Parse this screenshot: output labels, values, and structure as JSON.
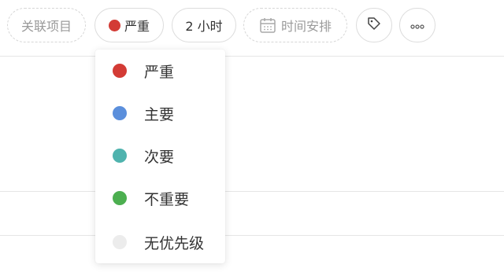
{
  "toolbar": {
    "project_label": "关联项目",
    "priority_label": "严重",
    "priority_color": "#d33b35",
    "hours_label": "2 小时",
    "schedule_label": "时间安排",
    "tag_icon": "tag-icon",
    "more_icon": "more-icon"
  },
  "priority_menu": {
    "options": [
      {
        "label": "严重",
        "color": "#d33b35"
      },
      {
        "label": "主要",
        "color": "#5b8fdc"
      },
      {
        "label": "次要",
        "color": "#4fb3ae"
      },
      {
        "label": "不重要",
        "color": "#4caf50"
      },
      {
        "label": "无优先级",
        "color": "#ececec"
      }
    ]
  }
}
